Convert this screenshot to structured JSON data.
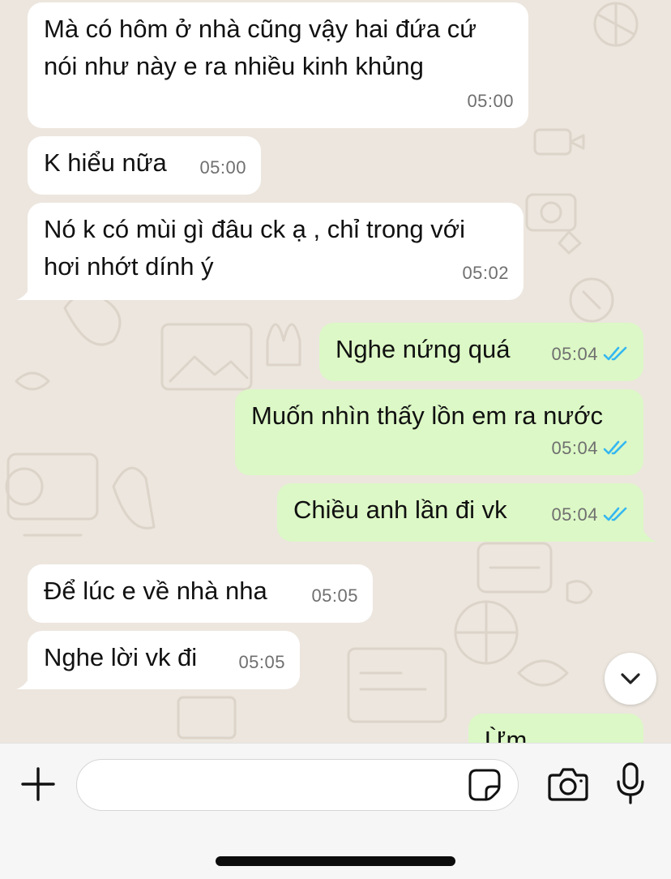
{
  "messages": [
    {
      "direction": "in",
      "text": "Mà có hôm ở nhà cũng vậy hai đứa cứ nói như này e ra nhiều kinh khủng",
      "time": "05:00"
    },
    {
      "direction": "in",
      "text": "K hiểu nữa",
      "time": "05:00"
    },
    {
      "direction": "in",
      "text": "Nó k có mùi gì đâu ck ạ , chỉ trong với hơi nhớt dính ý",
      "time": "05:02"
    },
    {
      "direction": "out",
      "text": "Nghe nứng quá",
      "time": "05:04",
      "status": "read"
    },
    {
      "direction": "out",
      "text": "Muốn nhìn thấy lồn em ra nước",
      "time": "05:04",
      "status": "read"
    },
    {
      "direction": "out",
      "text": "Chiều anh lần đi vk",
      "time": "05:04",
      "status": "read"
    },
    {
      "direction": "in",
      "text": "Để lúc e về nhà nha",
      "time": "05:05"
    },
    {
      "direction": "in",
      "text": "Nghe lời vk đi",
      "time": "05:05"
    },
    {
      "direction": "out",
      "text": "Ừm",
      "time": "",
      "status": "read",
      "partial": true
    }
  ],
  "message_lines": {
    "m0": [
      "Mà có hôm ở nhà cũng vậy hai đứa cứ",
      "nói như này e ra nhiều kinh khủng"
    ],
    "m2": [
      "Nó k có mùi gì đâu ck ạ , chỉ trong với",
      "hơi nhớt dính ý"
    ]
  },
  "composer": {
    "input_value": "",
    "icons": [
      "plus-icon",
      "sticker-icon",
      "camera-icon",
      "microphone-icon"
    ]
  },
  "scroll_button": {
    "icon": "chevron-down-icon"
  },
  "colors": {
    "chat_background": "#ece6de",
    "incoming_bubble": "#ffffff",
    "outgoing_bubble": "#dcf8c6",
    "read_tick": "#34b7f1",
    "timestamp": "#6f6f6f"
  }
}
